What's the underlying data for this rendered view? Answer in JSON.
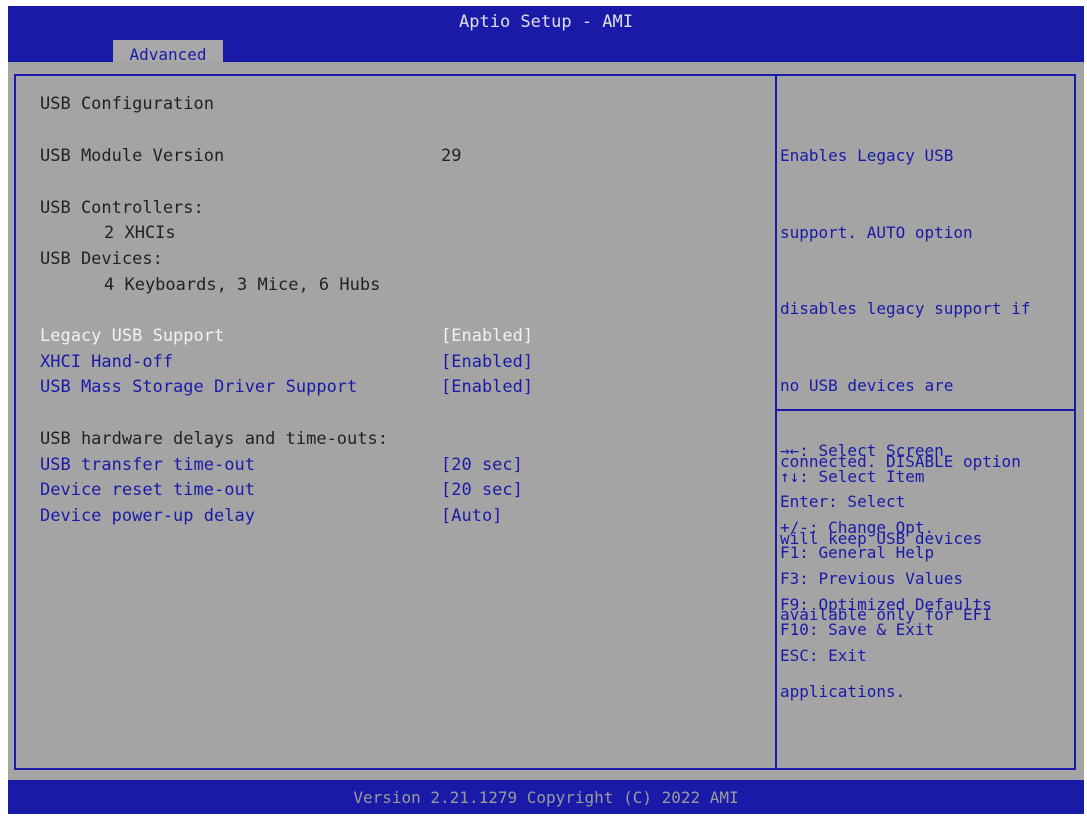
{
  "header": {
    "title": "Aptio Setup - AMI",
    "tab": "Advanced"
  },
  "settings": {
    "section_title": "USB Configuration",
    "module_version_label": "USB Module Version",
    "module_version_value": "29",
    "controllers_label": "USB Controllers:",
    "controllers_value": "2 XHCIs",
    "devices_label": "USB Devices:",
    "devices_value": "4 Keyboards, 3 Mice, 6 Hubs",
    "options": [
      {
        "label": "Legacy USB Support",
        "value": "[Enabled]",
        "selected": true
      },
      {
        "label": "XHCI Hand-off",
        "value": "[Enabled]",
        "selected": false
      },
      {
        "label": "USB Mass Storage Driver Support",
        "value": "[Enabled]",
        "selected": false
      }
    ],
    "delays_heading": "USB hardware delays and time-outs:",
    "delay_options": [
      {
        "label": "USB transfer time-out",
        "value": "[20 sec]"
      },
      {
        "label": "Device reset time-out",
        "value": "[20 sec]"
      },
      {
        "label": "Device power-up delay",
        "value": "[Auto]"
      }
    ]
  },
  "help": {
    "lines": [
      "Enables Legacy USB",
      "support. AUTO option",
      "disables legacy support if",
      "no USB devices are",
      "connected. DISABLE option",
      "will keep USB devices",
      "available only for EFI",
      "applications."
    ]
  },
  "keys": [
    "→←: Select Screen",
    "↑↓: Select Item",
    "Enter: Select",
    "+/-: Change Opt.",
    "F1: General Help",
    "F3: Previous Values",
    "F9: Optimized Defaults",
    "F10: Save & Exit",
    "ESC: Exit"
  ],
  "footer": {
    "text": "Version 2.21.1279 Copyright (C) 2022 AMI"
  },
  "colors": {
    "bar_blue": "#1a1aa8",
    "panel_gray": "#a4a4a4",
    "option_blue": "#1a1aa8",
    "selected_white": "#f2f2f2"
  }
}
